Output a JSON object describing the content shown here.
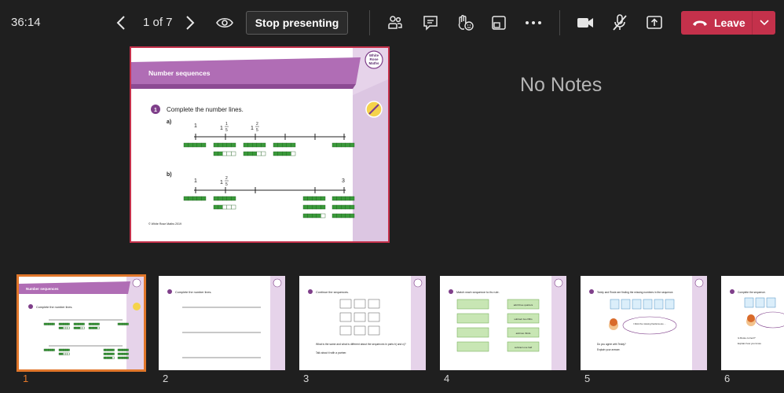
{
  "toolbar": {
    "timer": "36:14",
    "page_count": "1 of 7",
    "stop_presenting_label": "Stop presenting",
    "leave_label": "Leave",
    "accent_leave": "#c4314b"
  },
  "notes": {
    "text": "No Notes"
  },
  "slide": {
    "title": "Number sequences",
    "brand_line1": "White",
    "brand_line2": "Rose",
    "brand_line3": "Maths",
    "question_number": "1",
    "instruction": "Complete the number lines.",
    "part_a_label": "a)",
    "part_b_label": "b)",
    "a_tick_one": "1",
    "a_tick_whole": "1",
    "a_tick_num1": "1",
    "a_tick_den1": "5",
    "a_tick_whole2": "1",
    "a_tick_num2": "2",
    "a_tick_den2": "5",
    "b_tick_one": "1",
    "b_tick_whole": "1",
    "b_tick_num": "2",
    "b_tick_den": "5",
    "b_tick_three": "3",
    "footer": "© White Rose Maths 2019"
  },
  "filmstrip": {
    "thumbs": [
      {
        "number": "1",
        "caption": "Number sequences",
        "text": "Complete the number lines."
      },
      {
        "number": "2",
        "text": "Complete the number lines."
      },
      {
        "number": "3",
        "text": "Continue the sequences.",
        "prompt": "What is the same and what is different about the sequences in parts b) and c)?",
        "prompt2": "Talk about it with a partner."
      },
      {
        "number": "4",
        "text": "Match each sequence to its rule.",
        "rules": [
          "add three quarters",
          "subtract two fifths",
          "add two thirds",
          "subtract one half"
        ]
      },
      {
        "number": "5",
        "text": "Teddy and Rosie are finding the missing numbers in the sequence.",
        "speech": "I think the missing fractions are ...",
        "question": "Do you agree with Teddy?",
        "question2": "Explain your answer."
      },
      {
        "number": "6",
        "text": "Complete the sequence.",
        "question": "Is Rosie correct?",
        "question2": "Explain how you know."
      }
    ]
  }
}
